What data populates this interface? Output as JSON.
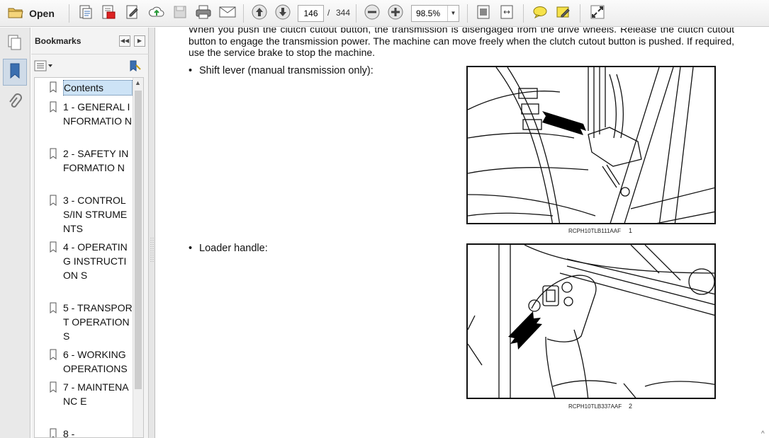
{
  "toolbar": {
    "open_label": "Open",
    "page_current": "146",
    "page_separator": "/",
    "page_total": "344",
    "zoom": "98.5%"
  },
  "bookmarks": {
    "title": "Bookmarks",
    "items": [
      {
        "label": "Contents"
      },
      {
        "label": "1 - GENERAL INFORMATIO N"
      },
      {
        "label": "2 - SAFETY INFORMATIO N"
      },
      {
        "label": "3 - CONTROLS/IN STRUMENTS"
      },
      {
        "label": "4 - OPERATING INSTRUCTION S"
      },
      {
        "label": "5 - TRANSPORT OPERATIONS"
      },
      {
        "label": "6 - WORKING OPERATIONS"
      },
      {
        "label": "7 - MAINTENANC E"
      },
      {
        "label": "8 -"
      }
    ]
  },
  "document": {
    "paragraph": "When you push the clutch cutout button, the transmission is disengaged from the drive wheels. Release the clutch cutout button to engage the transmission power. The machine can move freely when the clutch cutout button is pushed. If required, use the service brake to stop the machine.",
    "bullet1": "Shift lever (manual transmission only):",
    "bullet2": "Loader handle:",
    "figure1": {
      "caption": "RCPH10TLB111AAF",
      "number": "1"
    },
    "figure2": {
      "caption": "RCPH10TLB337AAF",
      "number": "2"
    }
  },
  "colors": {
    "selection": "#cde3f6",
    "toolbar_bg": "#ececec",
    "panel_bg": "#f3f3f3"
  }
}
